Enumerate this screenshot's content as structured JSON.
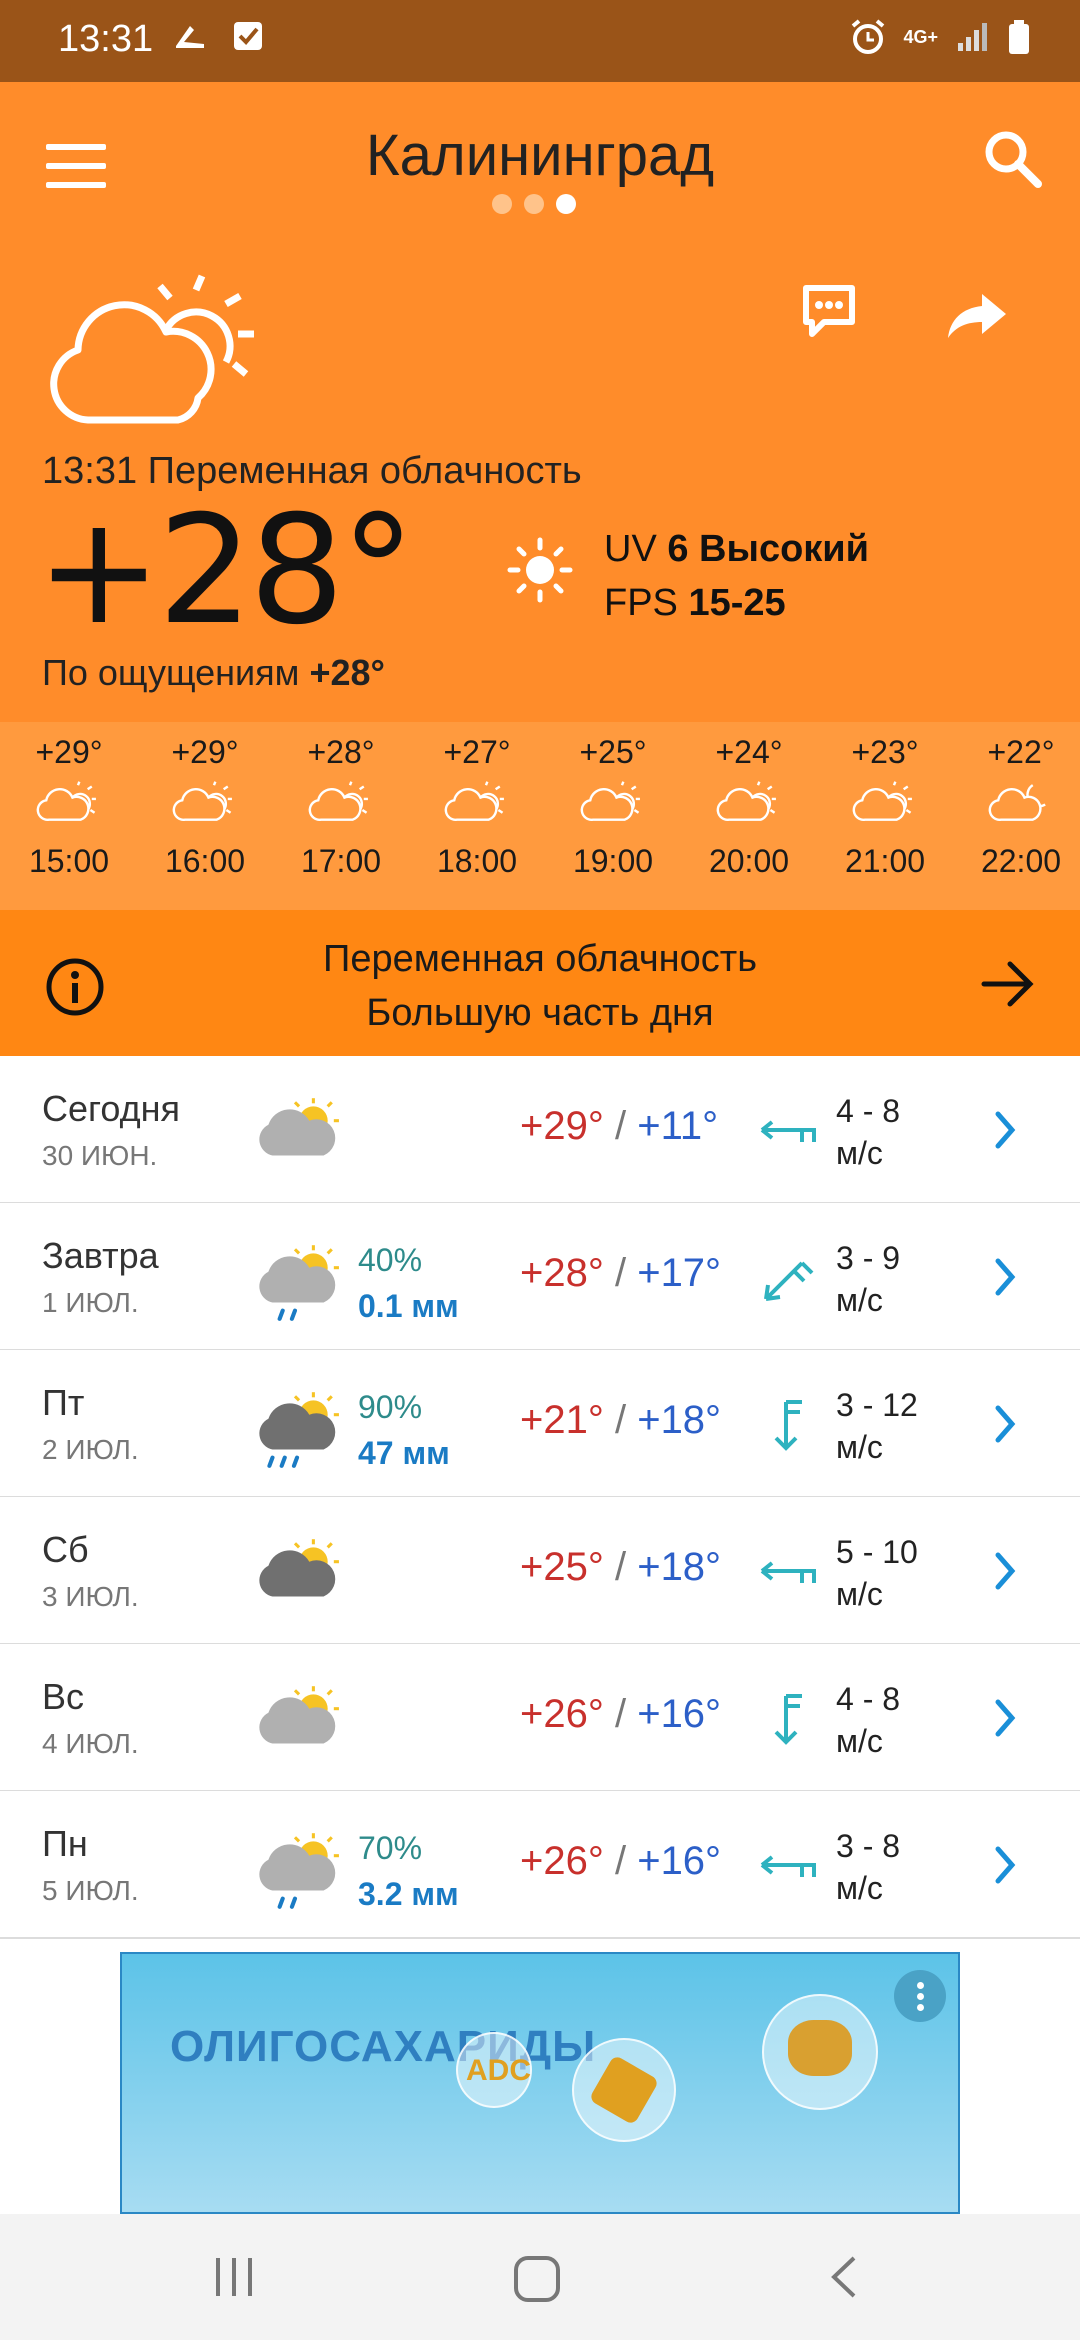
{
  "status": {
    "time": "13:31",
    "network": "4G+"
  },
  "header": {
    "city": "Калининград",
    "condition_line": "13:31 Переменная облачность",
    "temperature": "+28°",
    "feels_label": "По ощущениям",
    "feels_value": "+28°",
    "uv_label": "UV",
    "uv_value": "6 Высокий",
    "fps_label": "FPS",
    "fps_value": "15-25",
    "page_dots": 3,
    "active_dot": 3
  },
  "hourly": [
    {
      "temp": "+29°",
      "time": "15:00",
      "icon": "partly-cloudy-icon"
    },
    {
      "temp": "+29°",
      "time": "16:00",
      "icon": "partly-cloudy-icon"
    },
    {
      "temp": "+28°",
      "time": "17:00",
      "icon": "partly-cloudy-icon"
    },
    {
      "temp": "+27°",
      "time": "18:00",
      "icon": "partly-cloudy-icon"
    },
    {
      "temp": "+25°",
      "time": "19:00",
      "icon": "partly-cloudy-icon"
    },
    {
      "temp": "+24°",
      "time": "20:00",
      "icon": "partly-cloudy-icon"
    },
    {
      "temp": "+23°",
      "time": "21:00",
      "icon": "partly-cloudy-icon"
    },
    {
      "temp": "+22°",
      "time": "22:00",
      "icon": "partly-cloudy-night-icon"
    }
  ],
  "banner": {
    "line1": "Переменная облачность",
    "line2": "Большую часть дня"
  },
  "days": [
    {
      "name": "Сегодня",
      "date": "30 ИЮН.",
      "precip_pct": "",
      "precip_mm": "",
      "tmax": "+29°",
      "tmin": "+11°",
      "wind": "4 - 8",
      "unit": "м/с",
      "icon": "cloud-sun-icon",
      "wind_icon": "wind-west-icon"
    },
    {
      "name": "Завтра",
      "date": "1 ИЮЛ.",
      "precip_pct": "40%",
      "precip_mm": "0.1 мм",
      "tmax": "+28°",
      "tmin": "+17°",
      "wind": "3 - 9",
      "unit": "м/с",
      "icon": "cloud-sun-rain-icon",
      "wind_icon": "wind-southwest-icon"
    },
    {
      "name": "Пт",
      "date": "2 ИЮЛ.",
      "precip_pct": "90%",
      "precip_mm": "47 мм",
      "tmax": "+21°",
      "tmin": "+18°",
      "wind": "3 - 12",
      "unit": "м/с",
      "icon": "cloud-sun-heavy-rain-icon",
      "wind_icon": "wind-south-icon"
    },
    {
      "name": "Сб",
      "date": "3 ИЮЛ.",
      "precip_pct": "",
      "precip_mm": "",
      "tmax": "+25°",
      "tmin": "+18°",
      "wind": "5 - 10",
      "unit": "м/с",
      "icon": "dark-cloud-sun-icon",
      "wind_icon": "wind-west-icon"
    },
    {
      "name": "Вс",
      "date": "4 ИЮЛ.",
      "precip_pct": "",
      "precip_mm": "",
      "tmax": "+26°",
      "tmin": "+16°",
      "wind": "4 - 8",
      "unit": "м/с",
      "icon": "cloud-sun-icon",
      "wind_icon": "wind-south-icon"
    },
    {
      "name": "Пн",
      "date": "5 ИЮЛ.",
      "precip_pct": "70%",
      "precip_mm": "3.2 мм",
      "tmax": "+26°",
      "tmin": "+16°",
      "wind": "3 - 8",
      "unit": "м/с",
      "icon": "cloud-sun-rain-icon",
      "wind_icon": "wind-west-icon"
    }
  ],
  "ad": {
    "title": "ОЛИГОСАХАРИДЫ",
    "badge": "ADC"
  },
  "colors": {
    "status_bar": "#9a5418",
    "header": "#ff8c2a",
    "hourly": "#ff9a3e",
    "banner": "#ff8713",
    "temp_max": "#c8302c",
    "temp_min": "#2c5fc8",
    "precip": "#1a7bc4",
    "chevron": "#1a8fd8"
  }
}
